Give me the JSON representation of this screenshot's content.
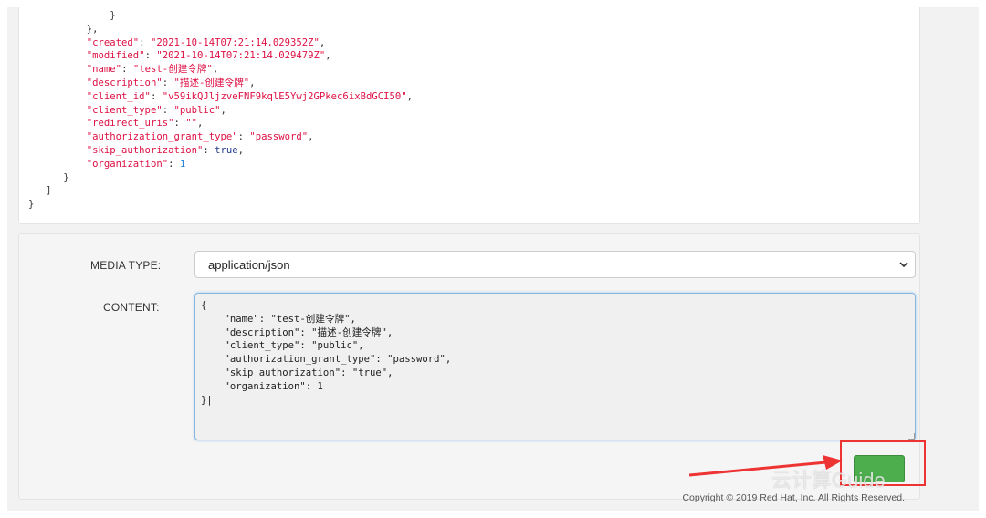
{
  "response": {
    "lines": [
      {
        "indent": 14,
        "parts": [
          [
            "p",
            "}"
          ]
        ]
      },
      {
        "indent": 10,
        "parts": [
          [
            "p",
            "},"
          ]
        ]
      },
      {
        "indent": 10,
        "parts": [
          [
            "k",
            "\"created\""
          ],
          [
            "p",
            ": "
          ],
          [
            "s",
            "\"2021-10-14T07:21:14.029352Z\""
          ],
          [
            "p",
            ","
          ]
        ]
      },
      {
        "indent": 10,
        "parts": [
          [
            "k",
            "\"modified\""
          ],
          [
            "p",
            ": "
          ],
          [
            "s",
            "\"2021-10-14T07:21:14.029479Z\""
          ],
          [
            "p",
            ","
          ]
        ]
      },
      {
        "indent": 10,
        "parts": [
          [
            "k",
            "\"name\""
          ],
          [
            "p",
            ": "
          ],
          [
            "s",
            "\"test-创建令牌\""
          ],
          [
            "p",
            ","
          ]
        ]
      },
      {
        "indent": 10,
        "parts": [
          [
            "k",
            "\"description\""
          ],
          [
            "p",
            ": "
          ],
          [
            "s",
            "\"描述-创建令牌\""
          ],
          [
            "p",
            ","
          ]
        ]
      },
      {
        "indent": 10,
        "parts": [
          [
            "k",
            "\"client_id\""
          ],
          [
            "p",
            ": "
          ],
          [
            "s",
            "\"v59ikQJljzveFNF9kqlE5Ywj2GPkec6ixBdGCI50\""
          ],
          [
            "p",
            ","
          ]
        ]
      },
      {
        "indent": 10,
        "parts": [
          [
            "k",
            "\"client_type\""
          ],
          [
            "p",
            ": "
          ],
          [
            "s",
            "\"public\""
          ],
          [
            "p",
            ","
          ]
        ]
      },
      {
        "indent": 10,
        "parts": [
          [
            "k",
            "\"redirect_uris\""
          ],
          [
            "p",
            ": "
          ],
          [
            "s",
            "\"\""
          ],
          [
            "p",
            ","
          ]
        ]
      },
      {
        "indent": 10,
        "parts": [
          [
            "k",
            "\"authorization_grant_type\""
          ],
          [
            "p",
            ": "
          ],
          [
            "s",
            "\"password\""
          ],
          [
            "p",
            ","
          ]
        ]
      },
      {
        "indent": 10,
        "parts": [
          [
            "k",
            "\"skip_authorization\""
          ],
          [
            "p",
            ": "
          ],
          [
            "b",
            "true"
          ],
          [
            "p",
            ","
          ]
        ]
      },
      {
        "indent": 10,
        "parts": [
          [
            "k",
            "\"organization\""
          ],
          [
            "p",
            ": "
          ],
          [
            "n",
            "1"
          ]
        ]
      },
      {
        "indent": 6,
        "parts": [
          [
            "p",
            "}"
          ]
        ]
      },
      {
        "indent": 3,
        "parts": [
          [
            "p",
            "]"
          ]
        ]
      },
      {
        "indent": 0,
        "parts": [
          [
            "p",
            "}"
          ]
        ]
      }
    ]
  },
  "form": {
    "media_type_label": "MEDIA TYPE:",
    "media_type_value": "application/json",
    "content_label": "CONTENT:",
    "content_value": "{\n    \"name\": \"test-创建令牌\",\n    \"description\": \"描述-创建令牌\",\n    \"client_type\": \"public\",\n    \"authorization_grant_type\": \"password\",\n    \"skip_authorization\": \"true\",\n    \"organization\": 1\n}|",
    "submit_label": "",
    "copyright": "Copyright © 2019 Red Hat, Inc. All Rights Reserved."
  },
  "watermark": "云计算Guide",
  "colors": {
    "key_string": "#dd1144",
    "number": "#1c7dd6",
    "boolean": "#1d3a8a",
    "submit_green": "#4cae4c",
    "highlight_red": "#ee3333"
  },
  "icons": [
    "chevron-down-icon",
    "resize-handle-icon",
    "arrow-pointer-icon"
  ]
}
